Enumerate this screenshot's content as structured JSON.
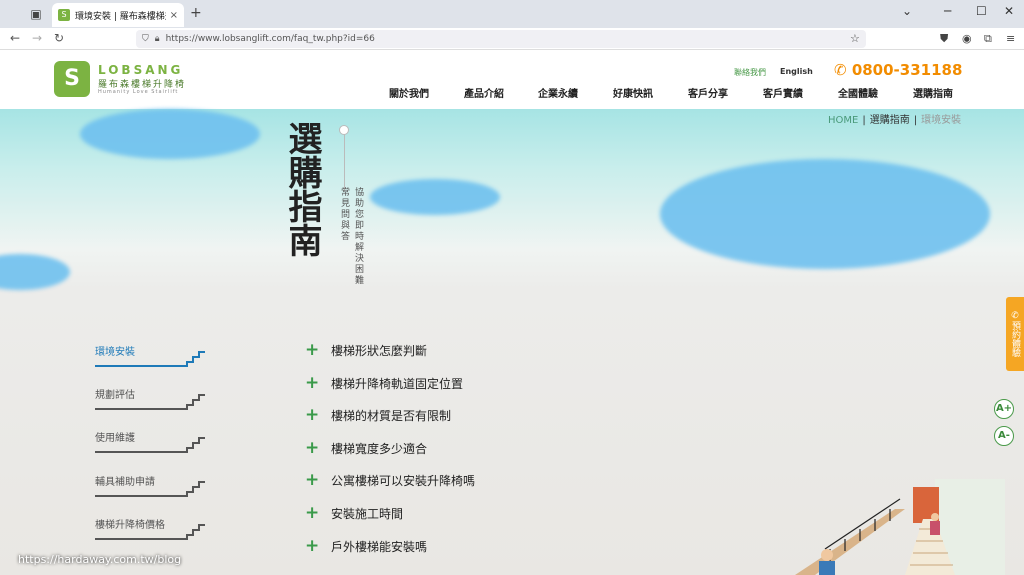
{
  "browser": {
    "tab_title": "環境安裝 | 羅布森樓梯升降椅",
    "tab_close": "×",
    "new_tab": "+",
    "url": "https://www.lobsanglift.com/faq_tw.php?id=66"
  },
  "header": {
    "logo_en": "LOBSANG",
    "logo_zh": "羅布森樓梯升降椅",
    "logo_sub": "Humanity Love Stairlift",
    "contact_label": "聯絡我們",
    "english_label": "English",
    "phone": "0800-331188",
    "menu": [
      "關於我們",
      "產品介紹",
      "企業永續",
      "好康快訊",
      "客戶分享",
      "客戶實績",
      "全國體驗",
      "選購指南"
    ]
  },
  "breadcrumb": {
    "home": "HOME",
    "parent": "選購指南",
    "current": "環境安裝"
  },
  "title": {
    "main": "選購指南",
    "sub1": "常見問與答",
    "sub2": "協助您即時解決困難"
  },
  "sidebar": {
    "items": [
      "環境安裝",
      "規劃評估",
      "使用維護",
      "輔具補助申請",
      "樓梯升降椅價格"
    ]
  },
  "faq": {
    "items": [
      "樓梯形狀怎麼判斷",
      "樓梯升降椅軌道固定位置",
      "樓梯的材質是否有限制",
      "樓梯寬度多少適合",
      "公寓樓梯可以安裝升降椅嗎",
      "安裝施工時間",
      "戶外樓梯能安裝嗎"
    ]
  },
  "side_widgets": {
    "reserve": "預約體驗",
    "font_up": "A+",
    "font_down": "A-"
  },
  "watermark": "https://hardaway.com.tw/blog",
  "colors": {
    "brand_green": "#7cb342",
    "phone_orange": "#f28c00",
    "active_blue": "#1e7ab8"
  }
}
